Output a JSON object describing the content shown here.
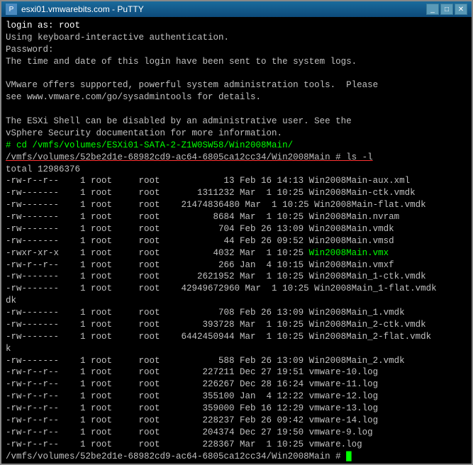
{
  "window": {
    "title": "esxi01.vmwarebits.com - PuTTY"
  },
  "terminal": {
    "lines": [
      {
        "text": "login as: root",
        "color": "normal"
      },
      {
        "text": "Using keyboard-interactive authentication.",
        "color": "normal"
      },
      {
        "text": "Password:",
        "color": "normal"
      },
      {
        "text": "The time and date of this login have been sent to the system logs.",
        "color": "normal"
      },
      {
        "text": "",
        "color": "normal"
      },
      {
        "text": "VMware offers supported, powerful system administration tools.  Please",
        "color": "normal"
      },
      {
        "text": "see www.vmware.com/go/sysadmintools for details.",
        "color": "normal"
      },
      {
        "text": "",
        "color": "normal"
      },
      {
        "text": "The ESXi Shell can be disabled by an administrative user. See the",
        "color": "normal"
      },
      {
        "text": "vSphere Security documentation for more information.",
        "color": "normal"
      },
      {
        "text": "# cd /vmfs/volumes/ESXi01-SATA-2-Z1W0SW58/Win2008Main/",
        "color": "green"
      },
      {
        "text": "/vmfs/volumes/52be2d1e-68982cd9-ac64-6805ca12cc34/Win2008Main # ls -l",
        "color": "underline"
      },
      {
        "text": "total 12986376",
        "color": "normal"
      },
      {
        "text": "-rw-r--r--    1 root     root            13 Feb 16 14:13 Win2008Main-aux.xml",
        "color": "normal"
      },
      {
        "text": "-rw-------    1 root     root       1311232 Mar  1 10:25 Win2008Main-ctk.vmdk",
        "color": "normal"
      },
      {
        "text": "-rw-------    1 root     root    21474836480 Mar  1 10:25 Win2008Main-flat.vmdk",
        "color": "normal"
      },
      {
        "text": "-rw-------    1 root     root          8684 Mar  1 10:25 Win2008Main.nvram",
        "color": "normal"
      },
      {
        "text": "-rw-------    1 root     root           704 Feb 26 13:09 Win2008Main.vmdk",
        "color": "normal"
      },
      {
        "text": "-rw-------    1 root     root            44 Feb 26 09:52 Win2008Main.vmsd",
        "color": "normal"
      },
      {
        "text": "-rwxr-xr-x    1 root     root          4032 Mar  1 10:25 Win2008Main.vmx",
        "color": "vmx"
      },
      {
        "text": "-rw-r--r--    1 root     root           266 Jan  4 10:15 Win2008Main.vmxf",
        "color": "normal"
      },
      {
        "text": "-rw-------    1 root     root       2621952 Mar  1 10:25 Win2008Main_1-ctk.vmdk",
        "color": "normal"
      },
      {
        "text": "-rw-------    1 root     root    42949672960 Mar  1 10:25 Win2008Main_1-flat.vmdk",
        "color": "normal"
      },
      {
        "text": "-rw-------    1 root     root           708 Feb 26 13:09 Win2008Main_1.vmdk",
        "color": "normal"
      },
      {
        "text": "-rw-------    1 root     root        393728 Mar  1 10:25 Win2008Main_2-ctk.vmdk",
        "color": "normal"
      },
      {
        "text": "-rw-------    1 root     root    6442450944 Mar  1 10:25 Win2008Main_2-flat.vmdk",
        "color": "normal"
      },
      {
        "text": "-rw-------    1 root     root           588 Feb 26 13:09 Win2008Main_2.vmdk",
        "color": "normal"
      },
      {
        "text": "-rw-r--r--    1 root     root        227211 Dec 27 19:51 vmware-10.log",
        "color": "normal"
      },
      {
        "text": "-rw-r--r--    1 root     root        226267 Dec 28 16:24 vmware-11.log",
        "color": "normal"
      },
      {
        "text": "-rw-r--r--    1 root     root        355100 Jan  4 12:22 vmware-12.log",
        "color": "normal"
      },
      {
        "text": "-rw-r--r--    1 root     root        359000 Feb 16 12:29 vmware-13.log",
        "color": "normal"
      },
      {
        "text": "-rw-r--r--    1 root     root        228237 Feb 26 09:42 vmware-14.log",
        "color": "normal"
      },
      {
        "text": "-rw-r--r--    1 root     root        204374 Dec 27 19:50 vmware-9.log",
        "color": "normal"
      },
      {
        "text": "-rw-r--r--    1 root     root        228367 Mar  1 10:25 vmware.log",
        "color": "normal"
      },
      {
        "text": "/vmfs/volumes/52be2d1e-68982cd9-ac64-6805ca12cc34/Win2008Main # ",
        "color": "prompt"
      }
    ]
  }
}
